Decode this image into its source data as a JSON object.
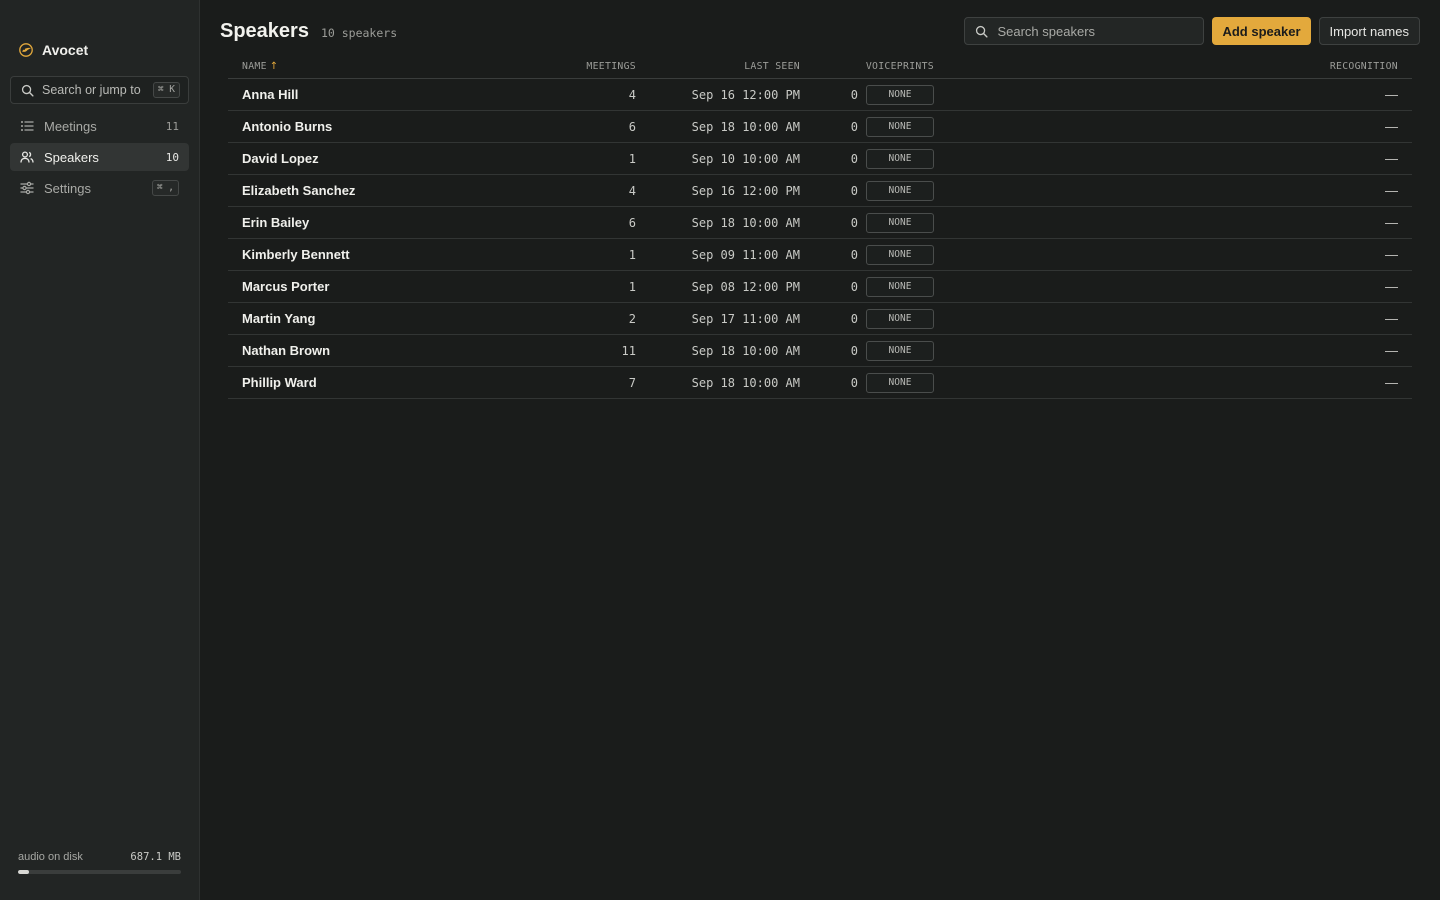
{
  "app": {
    "name": "Avocet",
    "logo_icon": "avocet-bird-icon",
    "accent_color": "#e3a93c"
  },
  "sidebar": {
    "jump": {
      "placeholder": "Search or jump to",
      "shortcut": "⌘ K"
    },
    "items": [
      {
        "label": "Meetings",
        "icon": "list-icon",
        "badge": "11"
      },
      {
        "label": "Speakers",
        "icon": "people-icon",
        "badge": "10",
        "active": true
      },
      {
        "label": "Settings",
        "icon": "sliders-icon",
        "badge": "⌘ ,"
      }
    ],
    "disk": {
      "label": "audio on disk",
      "value": "687.1 MB",
      "fill_fraction": 0.07
    }
  },
  "header": {
    "title": "Speakers",
    "subtitle": "10 speakers",
    "search_placeholder": "Search speakers",
    "add_button": "Add speaker",
    "import_button": "Import names"
  },
  "table": {
    "columns": {
      "name": "NAME",
      "sort_indicator": "↑",
      "meetings": "MEETINGS",
      "last_seen": "LAST SEEN",
      "voiceprints": "VOICEPRINTS",
      "recognition": "RECOGNITION"
    },
    "rows": [
      {
        "name": "Anna Hill",
        "meetings": "4",
        "last_seen": "Sep 16 12:00 PM",
        "voiceprints": "0",
        "status": "NONE",
        "recognition": "—"
      },
      {
        "name": "Antonio Burns",
        "meetings": "6",
        "last_seen": "Sep 18 10:00 AM",
        "voiceprints": "0",
        "status": "NONE",
        "recognition": "—"
      },
      {
        "name": "David Lopez",
        "meetings": "1",
        "last_seen": "Sep 10 10:00 AM",
        "voiceprints": "0",
        "status": "NONE",
        "recognition": "—"
      },
      {
        "name": "Elizabeth Sanchez",
        "meetings": "4",
        "last_seen": "Sep 16 12:00 PM",
        "voiceprints": "0",
        "status": "NONE",
        "recognition": "—"
      },
      {
        "name": "Erin Bailey",
        "meetings": "6",
        "last_seen": "Sep 18 10:00 AM",
        "voiceprints": "0",
        "status": "NONE",
        "recognition": "—"
      },
      {
        "name": "Kimberly Bennett",
        "meetings": "1",
        "last_seen": "Sep 09 11:00 AM",
        "voiceprints": "0",
        "status": "NONE",
        "recognition": "—"
      },
      {
        "name": "Marcus Porter",
        "meetings": "1",
        "last_seen": "Sep 08 12:00 PM",
        "voiceprints": "0",
        "status": "NONE",
        "recognition": "—"
      },
      {
        "name": "Martin Yang",
        "meetings": "2",
        "last_seen": "Sep 17 11:00 AM",
        "voiceprints": "0",
        "status": "NONE",
        "recognition": "—"
      },
      {
        "name": "Nathan Brown",
        "meetings": "11",
        "last_seen": "Sep 18 10:00 AM",
        "voiceprints": "0",
        "status": "NONE",
        "recognition": "—"
      },
      {
        "name": "Phillip Ward",
        "meetings": "7",
        "last_seen": "Sep 18 10:00 AM",
        "voiceprints": "0",
        "status": "NONE",
        "recognition": "—"
      }
    ]
  }
}
